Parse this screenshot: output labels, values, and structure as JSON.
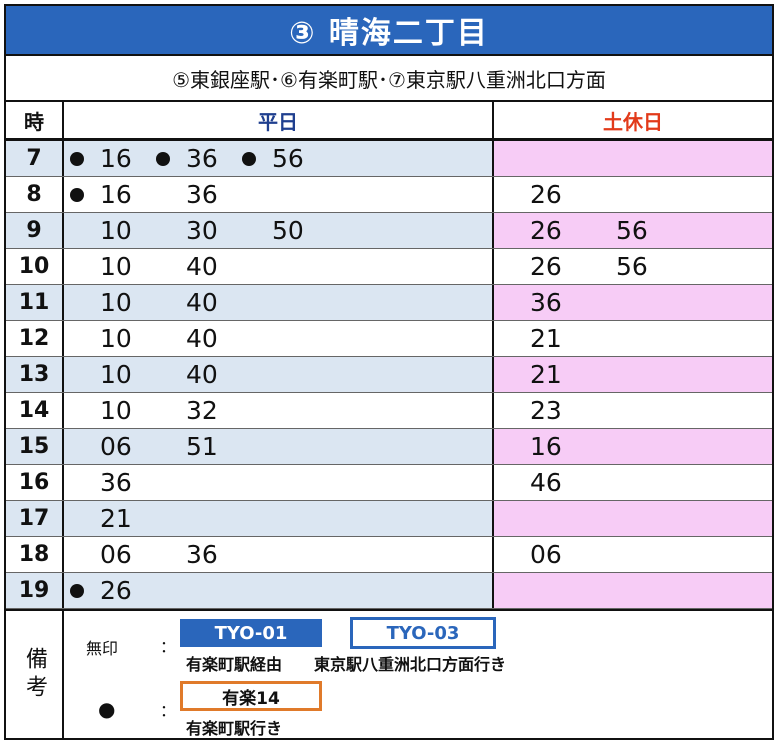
{
  "header": {
    "title": "③ 晴海二丁目",
    "subtitle": "⑤東銀座駅･⑥有楽町駅･⑦東京駅八重洲北口方面"
  },
  "columns": {
    "hour": "時",
    "weekday": "平日",
    "holiday": "土休日"
  },
  "colors": {
    "title_bg": "#2a66bb",
    "weekday_row": "#dbe6f2",
    "holiday_row": "#f7ccf6",
    "holiday_header": "#e23a1a",
    "badge_orange": "#e07a2a"
  },
  "rows": [
    {
      "hour": "7",
      "weekday": [
        {
          "m": "16",
          "dot": true
        },
        {
          "m": "36",
          "dot": true
        },
        {
          "m": "56",
          "dot": true
        }
      ],
      "holiday": []
    },
    {
      "hour": "8",
      "weekday": [
        {
          "m": "16",
          "dot": true
        },
        {
          "m": "36",
          "dot": false
        }
      ],
      "holiday": [
        "26"
      ]
    },
    {
      "hour": "9",
      "weekday": [
        {
          "m": "10",
          "dot": false
        },
        {
          "m": "30",
          "dot": false
        },
        {
          "m": "50",
          "dot": false
        }
      ],
      "holiday": [
        "26",
        "56"
      ]
    },
    {
      "hour": "10",
      "weekday": [
        {
          "m": "10",
          "dot": false
        },
        {
          "m": "40",
          "dot": false
        }
      ],
      "holiday": [
        "26",
        "56"
      ]
    },
    {
      "hour": "11",
      "weekday": [
        {
          "m": "10",
          "dot": false
        },
        {
          "m": "40",
          "dot": false
        }
      ],
      "holiday": [
        "36"
      ]
    },
    {
      "hour": "12",
      "weekday": [
        {
          "m": "10",
          "dot": false
        },
        {
          "m": "40",
          "dot": false
        }
      ],
      "holiday": [
        "21"
      ]
    },
    {
      "hour": "13",
      "weekday": [
        {
          "m": "10",
          "dot": false
        },
        {
          "m": "40",
          "dot": false
        }
      ],
      "holiday": [
        "21"
      ]
    },
    {
      "hour": "14",
      "weekday": [
        {
          "m": "10",
          "dot": false
        },
        {
          "m": "32",
          "dot": false
        }
      ],
      "holiday": [
        "23"
      ]
    },
    {
      "hour": "15",
      "weekday": [
        {
          "m": "06",
          "dot": false
        },
        {
          "m": "51",
          "dot": false
        }
      ],
      "holiday": [
        "16"
      ]
    },
    {
      "hour": "16",
      "weekday": [
        {
          "m": "36",
          "dot": false
        }
      ],
      "holiday": [
        "46"
      ]
    },
    {
      "hour": "17",
      "weekday": [
        {
          "m": "21",
          "dot": false
        }
      ],
      "holiday": []
    },
    {
      "hour": "18",
      "weekday": [
        {
          "m": "06",
          "dot": false
        },
        {
          "m": "36",
          "dot": false
        }
      ],
      "holiday": [
        "06"
      ]
    },
    {
      "hour": "19",
      "weekday": [
        {
          "m": "26",
          "dot": true
        }
      ],
      "holiday": []
    }
  ],
  "remarks": {
    "label": "備考",
    "no_mark_label": "無印",
    "colon": "：",
    "badge_tyo01": "TYO-01",
    "badge_tyo03": "TYO-03",
    "tyo01_desc": "有楽町駅経由",
    "tyo03_desc": "東京駅八重洲北口方面行き",
    "dot_symbol": "●",
    "badge_yuraku14": "有楽14",
    "yuraku14_desc": "有楽町駅行き"
  }
}
